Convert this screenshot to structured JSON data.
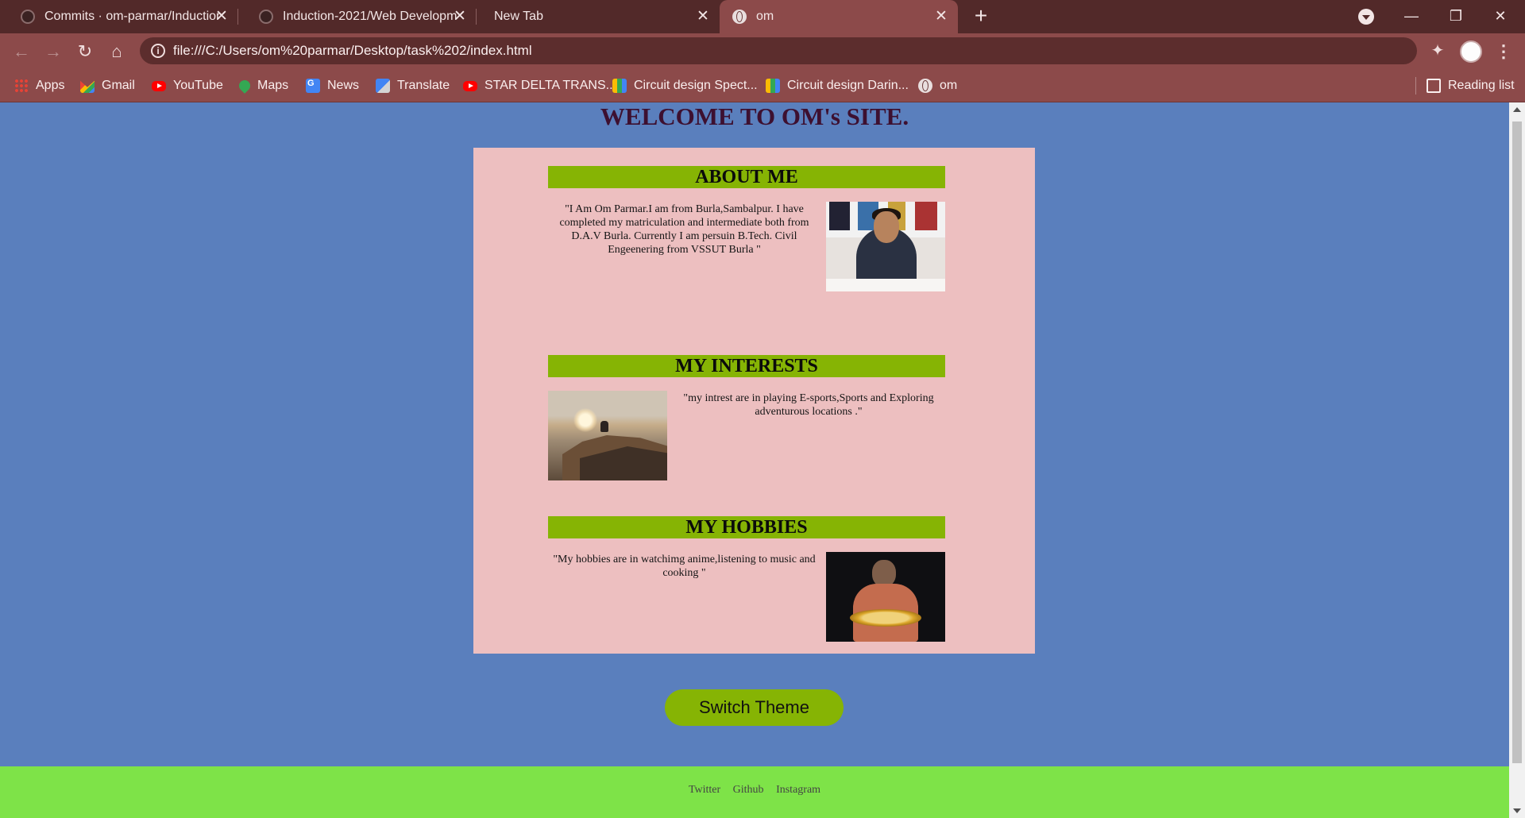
{
  "browser": {
    "tabs": [
      {
        "title": "Commits · om-parmar/Induction",
        "icon": "github-icon"
      },
      {
        "title": "Induction-2021/Web Developme",
        "icon": "github-icon"
      },
      {
        "title": "New Tab",
        "icon": ""
      },
      {
        "title": "om",
        "icon": "globe-icon"
      }
    ],
    "url": "file:///C:/Users/om%20parmar/Desktop/task%202/index.html",
    "bookmarks": [
      {
        "label": "Apps",
        "icon": "apps-grid-icon"
      },
      {
        "label": "Gmail",
        "icon": "gmail-icon"
      },
      {
        "label": "YouTube",
        "icon": "youtube-icon"
      },
      {
        "label": "Maps",
        "icon": "maps-icon"
      },
      {
        "label": "News",
        "icon": "news-icon"
      },
      {
        "label": "Translate",
        "icon": "translate-icon"
      },
      {
        "label": "STAR DELTA TRANS...",
        "icon": "youtube-icon"
      },
      {
        "label": "Circuit design Spect...",
        "icon": "circuit-icon"
      },
      {
        "label": "Circuit design Darin...",
        "icon": "circuit-icon"
      },
      {
        "label": "om",
        "icon": "globe-icon"
      }
    ],
    "reading_list": "Reading list",
    "colors": {
      "tabbar": "#522929",
      "toolbar": "#8c4a4a"
    }
  },
  "page": {
    "title": "WELCOME TO OM's SITE.",
    "sections": {
      "about": {
        "heading": "ABOUT ME",
        "text": "\"I Am Om Parmar.I am from Burla,Sambalpur. I have completed my matriculation and intermediate both from D.A.V Burla. Currently I am persuin B.Tech. Civil Engeenering from VSSUT Burla \""
      },
      "interests": {
        "heading": "MY INTERESTS",
        "text": "\"my intrest are in playing E-sports,Sports and Exploring adventurous locations .\""
      },
      "hobbies": {
        "heading": "MY HOBBIES",
        "text": "\"My hobbies are in watchimg anime,listening to music and cooking \""
      }
    },
    "switch_button": "Switch Theme",
    "footer_links": [
      "Twitter",
      "Github",
      "Instagram"
    ],
    "colors": {
      "background": "#5a7fbd",
      "card": "#edbfc0",
      "heading_bar": "#86b404",
      "footer": "#7ee348"
    }
  }
}
